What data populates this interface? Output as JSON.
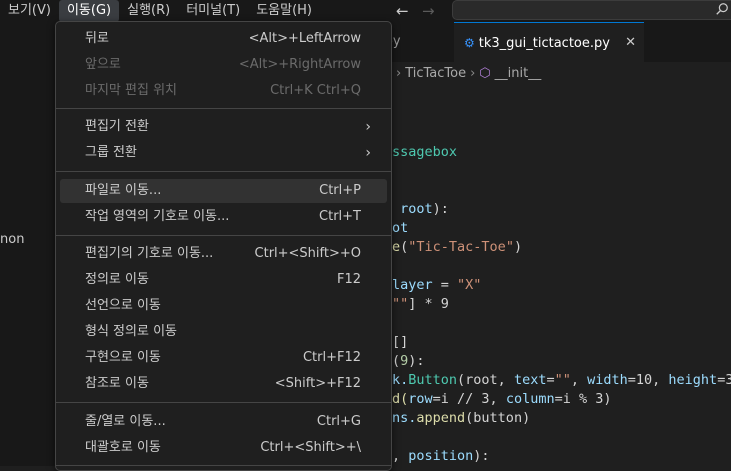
{
  "menubar": {
    "items": [
      "보기(V)",
      "이동(G)",
      "실행(R)",
      "터미널(T)",
      "도움말(H)"
    ],
    "active_index": 1
  },
  "nav": {
    "back_icon": "arrow-left-icon",
    "forward_icon": "arrow-right-icon"
  },
  "search": {
    "icon": "search-icon"
  },
  "sidebar": {
    "partial_label": "non"
  },
  "tabs": {
    "inactive": "app.py",
    "active": "tk3_gui_tictactoe.py",
    "close_glyph": "✕"
  },
  "breadcrumb": {
    "class_name": "TicTacToe",
    "method_name": "__init__"
  },
  "code": {
    "l1": "ssagebox",
    "l2_a": "root",
    "l2_b": "):",
    "l3": "ot",
    "l4_fn": "e",
    "l4_str": "\"Tic-Tac-Toe\"",
    "l5_var": "layer",
    "l5_str": "\"X\"",
    "l6_str": "\"\"",
    "l6_rest": "] * 9",
    "l7": "[]",
    "l8_num": "9",
    "l8_rest": "):",
    "l9_a": "k.",
    "l9_cls": "Button",
    "l9_b": "(root, ",
    "l9_c": "text",
    "l9_d": "=",
    "l9_str": "\"\"",
    "l9_e": ", ",
    "l9_f": "width",
    "l9_g": "=10, ",
    "l9_h": "height",
    "l9_i": "=3,",
    "l10_a": "d(",
    "l10_b": "row",
    "l10_c": "=i // 3, ",
    "l10_d": "column",
    "l10_e": "=i % 3)",
    "l11_a": "ns.",
    "l11_fn": "append",
    "l11_b": "(button)",
    "l12_a": ", ",
    "l12_b": "position",
    "l12_c": "):"
  },
  "dropdown": {
    "items": [
      {
        "label": "뒤로",
        "shortcut": "<Alt>+LeftArrow",
        "disabled": false
      },
      {
        "label": "앞으로",
        "shortcut": "<Alt>+RightArrow",
        "disabled": true
      },
      {
        "label": "마지막 편집 위치",
        "shortcut": "Ctrl+K Ctrl+Q",
        "disabled": true
      },
      {
        "label": "편집기 전환",
        "shortcut": "",
        "submenu": true
      },
      {
        "label": "그룹 전환",
        "shortcut": "",
        "submenu": true
      },
      {
        "label": "파일로 이동...",
        "shortcut": "Ctrl+P",
        "highlight": true
      },
      {
        "label": "작업 영역의 기호로 이동...",
        "shortcut": "Ctrl+T"
      },
      {
        "label": "편집기의 기호로 이동...",
        "shortcut": "Ctrl+<Shift>+O"
      },
      {
        "label": "정의로 이동",
        "shortcut": "F12"
      },
      {
        "label": "선언으로 이동",
        "shortcut": ""
      },
      {
        "label": "형식 정의로 이동",
        "shortcut": ""
      },
      {
        "label": "구현으로 이동",
        "shortcut": "Ctrl+F12"
      },
      {
        "label": "참조로 이동",
        "shortcut": "<Shift>+F12"
      },
      {
        "label": "줄/열로 이동...",
        "shortcut": "Ctrl+G"
      },
      {
        "label": "대괄호로 이동",
        "shortcut": "Ctrl+<Shift>+\\"
      }
    ],
    "submenu_glyph": "›"
  }
}
